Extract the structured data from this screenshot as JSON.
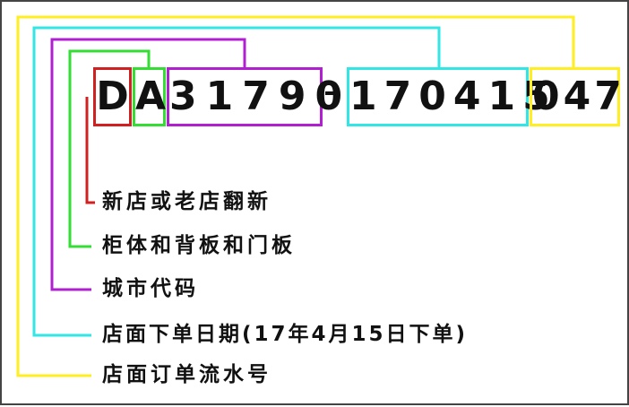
{
  "code": {
    "segments": [
      {
        "key": "renovation",
        "text": "D",
        "color": "#d02020"
      },
      {
        "key": "cabinet",
        "text": "A",
        "color": "#33dd33"
      },
      {
        "key": "city",
        "text": "31790",
        "color": "#b020d0"
      },
      {
        "key": "date",
        "text": "170415",
        "color": "#33e6e6"
      },
      {
        "key": "serial",
        "text": "047",
        "color": "#ffee22"
      }
    ],
    "separator": "-"
  },
  "labels": [
    {
      "key": "renovation",
      "text": "新店或老店翻新",
      "color": "#d02020"
    },
    {
      "key": "cabinet",
      "text": "柜体和背板和门板",
      "color": "#33dd33"
    },
    {
      "key": "city",
      "text": "城市代码",
      "color": "#b020d0"
    },
    {
      "key": "date",
      "text": "店面下单日期(17年4月15日下单)",
      "color": "#33e6e6"
    },
    {
      "key": "serial",
      "text": "店面订单流水号",
      "color": "#ffee22"
    }
  ]
}
